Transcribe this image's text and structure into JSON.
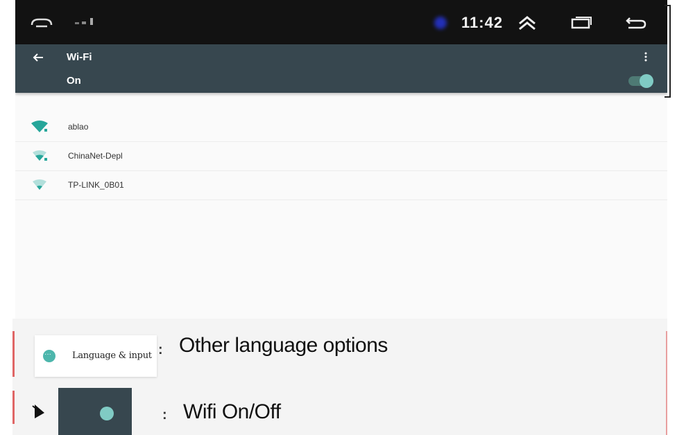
{
  "status_bar": {
    "time": "11:42",
    "icons": [
      "home-icon",
      "signal-icon",
      "notification-dot-icon",
      "chevron-up-icon",
      "recent-apps-icon",
      "back-icon"
    ]
  },
  "action_bar": {
    "title": "Wi-Fi",
    "toggle_label": "On",
    "toggle_on": true,
    "menu_icon": "more-vert-icon",
    "accent": "#80cbc4",
    "background": "#37474f"
  },
  "network_list": {
    "header": "",
    "networks": [
      {
        "name": "ablao",
        "signal": "full"
      },
      {
        "name": "ChinaNet-Depl",
        "signal": "medium"
      },
      {
        "name": "TP-LINK_0B01",
        "signal": "low"
      }
    ]
  },
  "annotations": {
    "language_item_label": "Language & input",
    "language_colon": ":",
    "language_note": "Other language options",
    "wifi_colon": ":",
    "wifi_note": "Wifi On/Off"
  }
}
